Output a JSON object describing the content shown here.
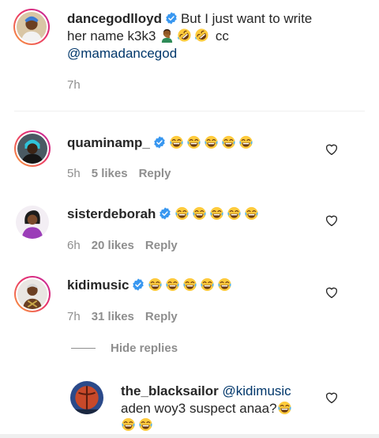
{
  "comments": [
    {
      "username": "dancegodlloyd",
      "text_line1": "But I just want to write",
      "text_line2_prefix": "her name k3k3",
      "text_line2_suffix": "cc",
      "mention": "@mamadancegod",
      "time": "7h"
    },
    {
      "username": "quaminamp_",
      "time": "5h",
      "likes": "5 likes",
      "reply": "Reply"
    },
    {
      "username": "sisterdeborah",
      "time": "6h",
      "likes": "20 likes",
      "reply": "Reply"
    },
    {
      "username": "kidimusic",
      "time": "7h",
      "likes": "31 likes",
      "reply": "Reply"
    }
  ],
  "hide_replies": "Hide replies",
  "reply_comment": {
    "username": "the_blacksailor",
    "mention": "@kidimusic",
    "text": "aden woy3 suspect anaa?"
  },
  "colors": {
    "text": "#262626",
    "muted": "#8e8e8e",
    "mention": "#00376b",
    "verified": "#3897f0",
    "divider": "#efefef"
  },
  "icons": [
    "verified-badge-icon",
    "heart-icon",
    "laughing-emoji",
    "rolling-laughing-emoji",
    "person-facepalming-emoji"
  ]
}
